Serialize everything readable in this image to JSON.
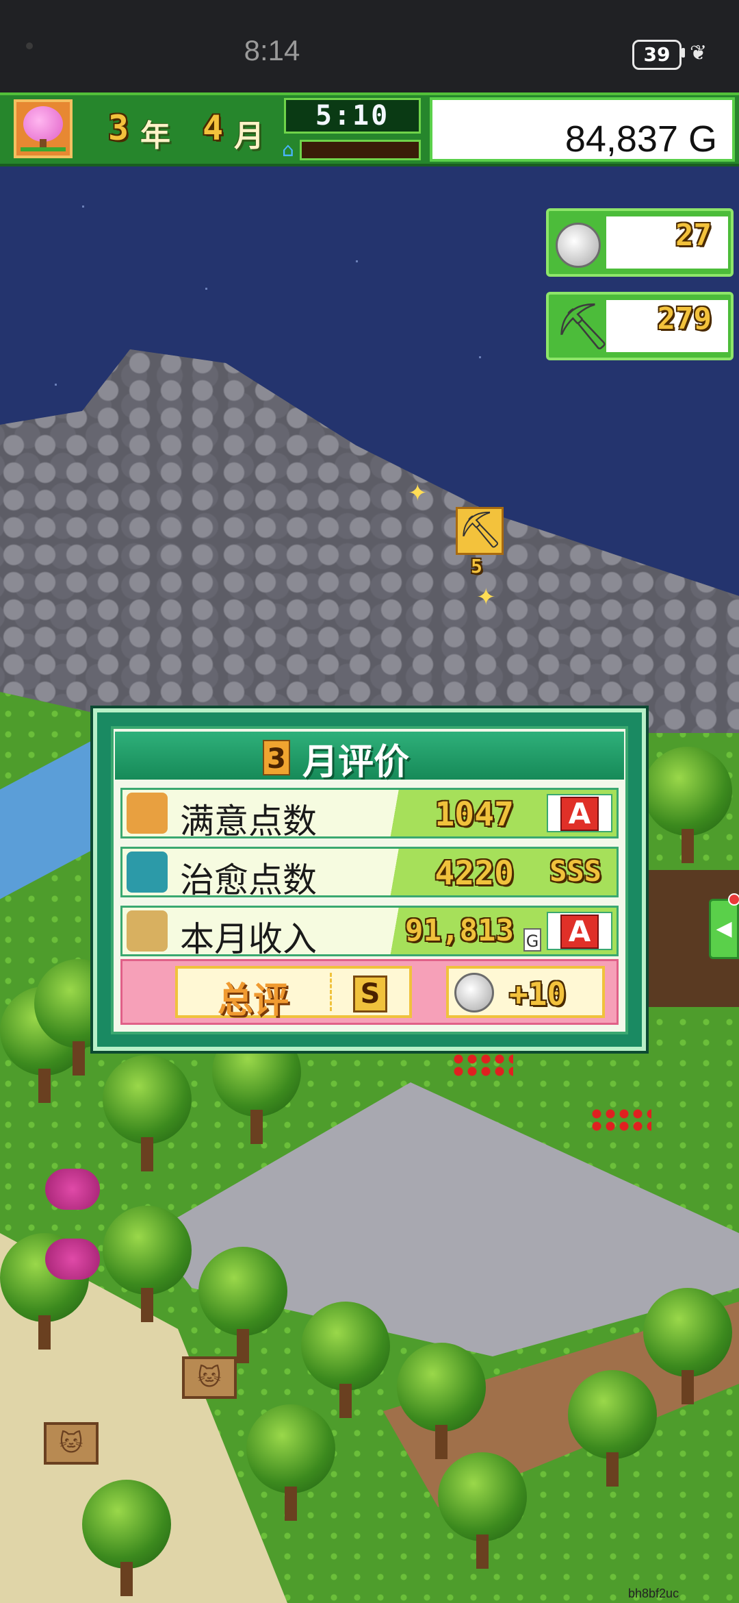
{
  "status_bar": {
    "time": "8:14",
    "battery": "39"
  },
  "hud": {
    "year_num": "3",
    "year_label": "年",
    "month_num": "4",
    "month_label": "月",
    "game_time": "5:10",
    "money": "84,837 G"
  },
  "counters": {
    "medals": "27",
    "pickaxes": "279"
  },
  "mine_marker": {
    "count": "5"
  },
  "evaluation": {
    "month_num": "3",
    "title": "月评价",
    "rows": [
      {
        "label": "满意点数",
        "value": "1047",
        "unit": "",
        "grade": "A"
      },
      {
        "label": "治愈点数",
        "value": "4220",
        "unit": "",
        "grade": "SSS"
      },
      {
        "label": "本月收入",
        "value": "91,813",
        "unit": "G",
        "grade": "A"
      }
    ],
    "total_label": "总评",
    "total_grade": "S",
    "reward": "+10"
  },
  "watermark": "bh8bf2uc",
  "colors": {
    "panel": "#1a8a62",
    "hud_bar": "#26862c",
    "sky": "#24346e"
  }
}
